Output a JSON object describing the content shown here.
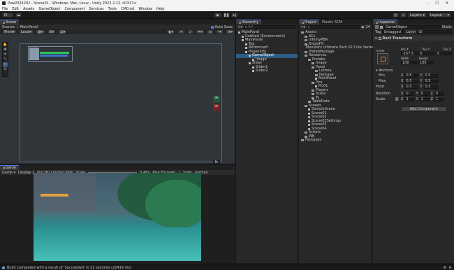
{
  "titlebar": {
    "title": "Pow2024202 - Scene01 - Windows, Mac, Linux - Unity 2022.2.12 <DX11>"
  },
  "menu": [
    "File",
    "Edit",
    "Assets",
    "GameObject",
    "Component",
    "Services",
    "Tools",
    "CMCmd",
    "Window",
    "Help"
  ],
  "toolbar": {
    "account": "lll",
    "layers": "Layers",
    "layout": "Layout"
  },
  "scene": {
    "tab": "Scene",
    "breadcrumb": [
      "Scenes",
      "MainPanel"
    ],
    "pivot": "Pivot",
    "local": "Local",
    "autosave": "Auto Save",
    "btn_labels": [
      "Ve",
      "Ve",
      "Rr"
    ]
  },
  "game": {
    "tab": "Game",
    "display": "Display 1",
    "resolution": "Full HD (1920x1080)",
    "scale_label": "Scale",
    "scale_value": "0.48x",
    "play_focused": "Play Focused",
    "stats": "Stats",
    "gizmos": "Gizmos"
  },
  "hierarchy": {
    "tab": "Hierarchy",
    "search_placeholder": "All",
    "items": [
      {
        "label": "MainPanel",
        "depth": 0,
        "kind": "cube"
      },
      {
        "label": "Untitled (Environment)",
        "depth": 1,
        "kind": "cube"
      },
      {
        "label": "MainPanel",
        "depth": 1,
        "kind": "cube"
      },
      {
        "label": "Top",
        "depth": 2,
        "kind": "cube"
      },
      {
        "label": "BottomLeft",
        "depth": 2,
        "kind": "cube"
      },
      {
        "label": "PlayerInfo",
        "depth": 2,
        "kind": "cube"
      },
      {
        "label": "GameObject",
        "depth": 3,
        "kind": "cube",
        "selected": true
      },
      {
        "label": "Image",
        "depth": 4,
        "kind": "cube"
      },
      {
        "label": "Slider",
        "depth": 3,
        "kind": "cube"
      },
      {
        "label": "Slider1",
        "depth": 4,
        "kind": "cube"
      },
      {
        "label": "Slider2",
        "depth": 4,
        "kind": "cube"
      }
    ]
  },
  "project": {
    "tabs": [
      "Project",
      "Plastic SCM"
    ],
    "items": [
      {
        "label": "Assets",
        "depth": 0,
        "kind": "folder"
      },
      {
        "label": "ACs",
        "depth": 1,
        "kind": "folder"
      },
      {
        "label": "InfinityPBR",
        "depth": 1,
        "kind": "folder"
      },
      {
        "label": "KriptoFX",
        "depth": 1,
        "kind": "folder"
      },
      {
        "label": "Monsters Ultimate Pack 02 Cute Series",
        "depth": 1,
        "kind": "folder"
      },
      {
        "label": "PrefabPackage",
        "depth": 1,
        "kind": "folder"
      },
      {
        "label": "Resources",
        "depth": 1,
        "kind": "folder"
      },
      {
        "label": "Prefabs",
        "depth": 2,
        "kind": "folder"
      },
      {
        "label": "Image",
        "depth": 3,
        "kind": "folder"
      },
      {
        "label": "Panel",
        "depth": 3,
        "kind": "folder"
      },
      {
        "label": "Lottery",
        "depth": 4,
        "kind": "folder"
      },
      {
        "label": "Package",
        "depth": 4,
        "kind": "folder"
      },
      {
        "label": "MainPanel",
        "depth": 4,
        "kind": "cube"
      },
      {
        "label": "Pics",
        "depth": 3,
        "kind": "folder"
      },
      {
        "label": "Pic01",
        "depth": 4,
        "kind": "cube"
      },
      {
        "label": "Players",
        "depth": 3,
        "kind": "folder"
      },
      {
        "label": "Scens",
        "depth": 3,
        "kind": "folder"
      },
      {
        "label": "Ty",
        "depth": 3,
        "kind": "folder"
      },
      {
        "label": "TableData",
        "depth": 2,
        "kind": "folder"
      },
      {
        "label": "Scenes",
        "depth": 1,
        "kind": "folder"
      },
      {
        "label": "SampleScene",
        "depth": 2,
        "kind": "scene"
      },
      {
        "label": "Scene01",
        "depth": 2,
        "kind": "scene"
      },
      {
        "label": "Scene02",
        "depth": 2,
        "kind": "scene"
      },
      {
        "label": "Scene02Settings",
        "depth": 2,
        "kind": "scene"
      },
      {
        "label": "Scene03",
        "depth": 2,
        "kind": "scene"
      },
      {
        "label": "Scene04",
        "depth": 2,
        "kind": "scene"
      },
      {
        "label": "Scripts",
        "depth": 1,
        "kind": "folder"
      },
      {
        "label": "WB",
        "depth": 1,
        "kind": "folder"
      },
      {
        "label": "Packages",
        "depth": 0,
        "kind": "folder"
      }
    ],
    "count": "24"
  },
  "inspector": {
    "tab": "Inspector",
    "object_name": "GameObject",
    "static_label": "Static",
    "tag_label": "Tag",
    "tag_value": "Untagged",
    "layer_label": "Layer",
    "layer_value": "UI",
    "component": "Rect Transform",
    "anchor_preset": "center",
    "pos_headers": [
      "Pos X",
      "Pos Y",
      "Pos Z"
    ],
    "pos_values": [
      "-157.5",
      "0",
      "0"
    ],
    "size_headers": [
      "Width",
      "Height"
    ],
    "size_values": [
      "100",
      "100"
    ],
    "anchors_label": "Anchors",
    "min_label": "Min",
    "min_x": "0.5",
    "min_y": "0.5",
    "max_label": "Max",
    "max_x": "0.5",
    "max_y": "0.5",
    "pivot_label": "Pivot",
    "pivot_x": "0.5",
    "pivot_y": "0.5",
    "rotation_label": "Rotation",
    "rot_x": "0",
    "rot_y": "0",
    "rot_z": "0",
    "scale_label": "Scale",
    "scale_x": "1",
    "scale_y": "1",
    "scale_z": "1",
    "add_component": "Add Component"
  },
  "status": {
    "message": "Build completed with a result of 'Succeeded' in 22 seconds (22419 ms)"
  },
  "colors": {
    "accent": "#2c5d87",
    "slider_green": "#2fc25a",
    "status_bar": "#191919",
    "water": "#2a8a8e",
    "sky": "#3f5a6b"
  }
}
